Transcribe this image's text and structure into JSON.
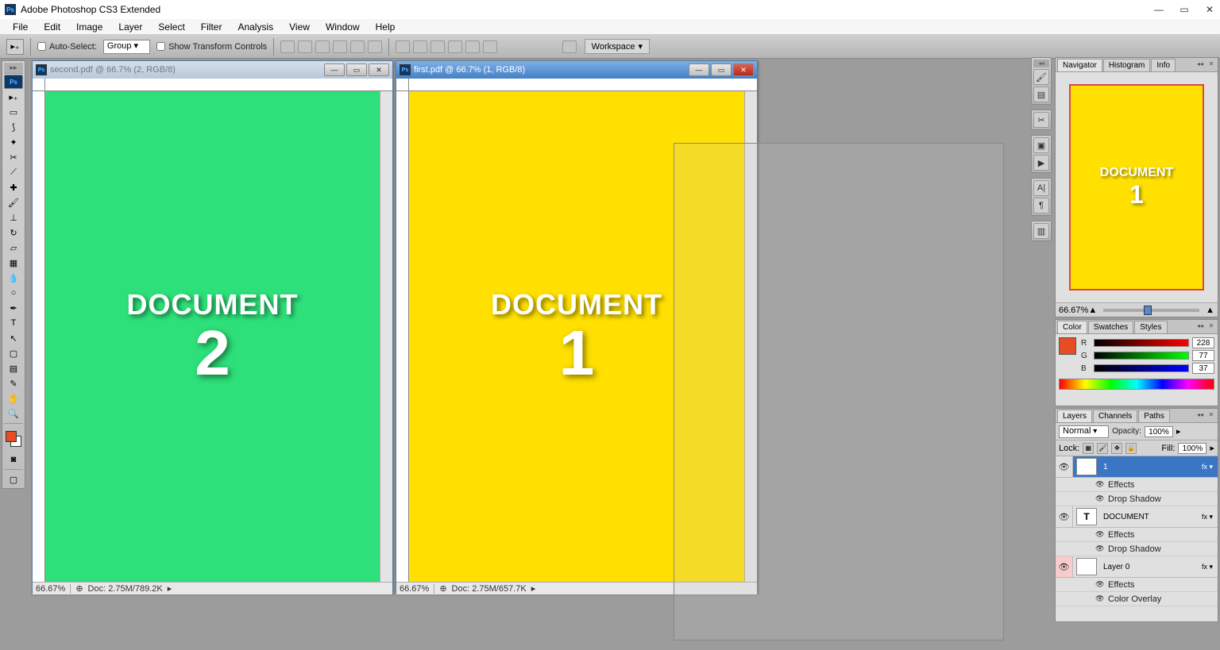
{
  "app": {
    "title": "Adobe Photoshop CS3 Extended"
  },
  "menu": [
    "File",
    "Edit",
    "Image",
    "Layer",
    "Select",
    "Filter",
    "Analysis",
    "View",
    "Window",
    "Help"
  ],
  "optbar": {
    "auto_select": "Auto-Select:",
    "auto_select_value": "Group",
    "show_transform": "Show Transform Controls",
    "workspace": "Workspace"
  },
  "docs": {
    "second": {
      "title": "second.pdf @ 66.7% (2, RGB/8)",
      "zoom": "66.67%",
      "docinfo": "Doc: 2.75M/789.2K",
      "canvas_word": "DOCUMENT",
      "canvas_num": "2",
      "bg": "#2de07a"
    },
    "first": {
      "title": "first.pdf @ 66.7% (1, RGB/8)",
      "zoom": "66.67%",
      "docinfo": "Doc: 2.75M/657.7K",
      "canvas_word": "DOCUMENT",
      "canvas_num": "1",
      "bg": "#ffe000"
    }
  },
  "navigator": {
    "tabs": [
      "Navigator",
      "Histogram",
      "Info"
    ],
    "zoom": "66.67%",
    "preview_word": "DOCUMENT",
    "preview_num": "1"
  },
  "color": {
    "tabs": [
      "Color",
      "Swatches",
      "Styles"
    ],
    "r": "228",
    "g": "77",
    "b": "37"
  },
  "layers": {
    "tabs": [
      "Layers",
      "Channels",
      "Paths"
    ],
    "blend": "Normal",
    "opacity_label": "Opacity:",
    "opacity": "100%",
    "lock_label": "Lock:",
    "fill_label": "Fill:",
    "fill": "100%",
    "items": [
      {
        "name": "1",
        "effects": "Effects",
        "sub": "Drop Shadow"
      },
      {
        "name": "DOCUMENT",
        "effects": "Effects",
        "sub": "Drop Shadow"
      },
      {
        "name": "Layer 0",
        "effects": "Effects",
        "sub": "Color Overlay"
      }
    ]
  }
}
